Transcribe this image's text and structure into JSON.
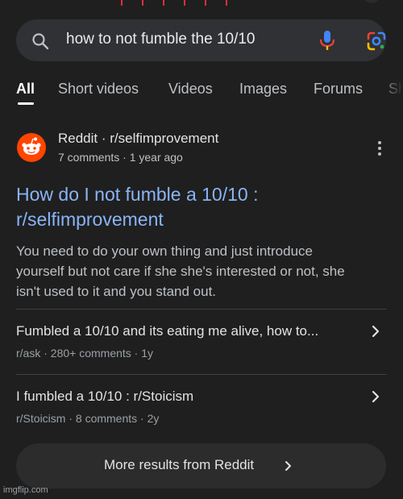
{
  "search": {
    "query": "how to not fumble the 10/10",
    "icons": {
      "search": "search-icon",
      "mic": "mic-icon",
      "lens": "google-lens-icon"
    }
  },
  "tabs": [
    {
      "label": "All",
      "active": true
    },
    {
      "label": "Short videos",
      "active": false
    },
    {
      "label": "Videos",
      "active": false
    },
    {
      "label": "Images",
      "active": false
    },
    {
      "label": "Forums",
      "active": false
    },
    {
      "label": "Sh",
      "active": false
    }
  ],
  "result": {
    "favicon": "reddit-logo-icon",
    "source": "Reddit · r/selfimprovement",
    "meta": "7 comments · 1 year ago",
    "title_line1": "How do I not fumble a 10/10 :",
    "title_line2": "r/selfimprovement",
    "snippet_line1": "You need to do your own thing and just introduce",
    "snippet_line2": "yourself but not care if she she's interested or not, she",
    "snippet_line3": "isn't used to it and you stand out.",
    "sub_results": [
      {
        "title": "Fumbled a 10/10 and its eating me alive, how to...",
        "meta": "r/ask · 280+ comments · 1y"
      },
      {
        "title": "I fumbled a 10/10 : r/Stoicism",
        "meta": "r/Stoicism · 8 comments · 2y"
      }
    ],
    "more_button": "More results from Reddit"
  },
  "colors": {
    "background": "#1f1f1f",
    "link": "#8ab4f8",
    "reddit_orange": "#ff4500",
    "mic_blue": "#4285f4",
    "mic_red": "#ea4335"
  },
  "watermark": "imgflip.com"
}
